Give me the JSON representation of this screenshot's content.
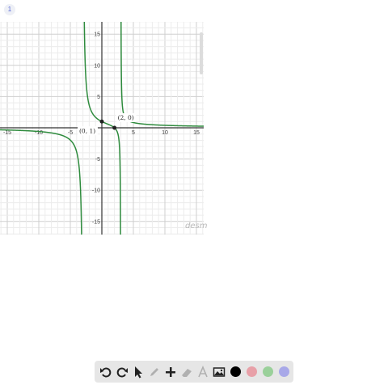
{
  "page_badge": "1",
  "graph": {
    "x_ticks": [
      "-15",
      "-10",
      "-5",
      "5",
      "10",
      "15"
    ],
    "y_ticks": [
      "15",
      "10",
      "5",
      "-5",
      "-10",
      "-15"
    ],
    "x_tick_values": [
      -15,
      -10,
      -5,
      5,
      10,
      15
    ],
    "y_tick_values": [
      15,
      10,
      5,
      -5,
      -10,
      -15
    ],
    "xlim": [
      -16,
      16
    ],
    "ylim": [
      -17,
      17
    ],
    "curve_color": "#2e8b3d",
    "points": [
      {
        "label": "(2, 0)",
        "x": 2,
        "y": 0
      },
      {
        "label": "(0, 1)",
        "x": 0,
        "y": 1
      }
    ],
    "watermark": "desm"
  },
  "toolbar": {
    "tools": [
      "undo-icon",
      "redo-icon",
      "pointer-icon",
      "pen-icon",
      "plus-icon",
      "eraser-icon",
      "text-icon",
      "image-icon"
    ],
    "colors": [
      "#000000",
      "#e8a0a8",
      "#9ad09a",
      "#a8a8e8"
    ]
  }
}
